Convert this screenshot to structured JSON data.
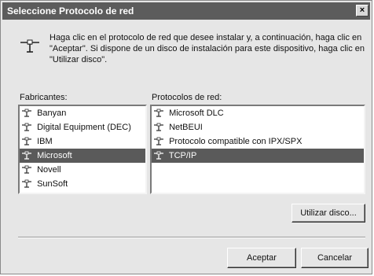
{
  "window": {
    "title": "Seleccione Protocolo de red",
    "close_glyph": "×"
  },
  "intro": {
    "icon": "network-protocol-icon",
    "text": "Haga clic en el protocolo de red que desee instalar y, a continuación, haga clic en \"Aceptar\". Si dispone de un disco de instalación para este dispositivo, haga clic en \"Utilizar disco\"."
  },
  "manufacturers": {
    "label": "Fabricantes:",
    "items": [
      {
        "label": "Banyan",
        "selected": false
      },
      {
        "label": "Digital Equipment (DEC)",
        "selected": false
      },
      {
        "label": "IBM",
        "selected": false
      },
      {
        "label": "Microsoft",
        "selected": true
      },
      {
        "label": "Novell",
        "selected": false
      },
      {
        "label": "SunSoft",
        "selected": false
      }
    ]
  },
  "protocols": {
    "label": "Protocolos de red:",
    "items": [
      {
        "label": "Microsoft DLC",
        "selected": false
      },
      {
        "label": "NetBEUI",
        "selected": false
      },
      {
        "label": "Protocolo compatible con IPX/SPX",
        "selected": false
      },
      {
        "label": "TCP/IP",
        "selected": true
      }
    ]
  },
  "buttons": {
    "have_disk": "Utilizar disco...",
    "ok": "Aceptar",
    "cancel": "Cancelar"
  },
  "colors": {
    "titlebar": "#5c5c5c",
    "selection": "#5a5a5a",
    "dialog_bg": "#e6e6e6"
  }
}
